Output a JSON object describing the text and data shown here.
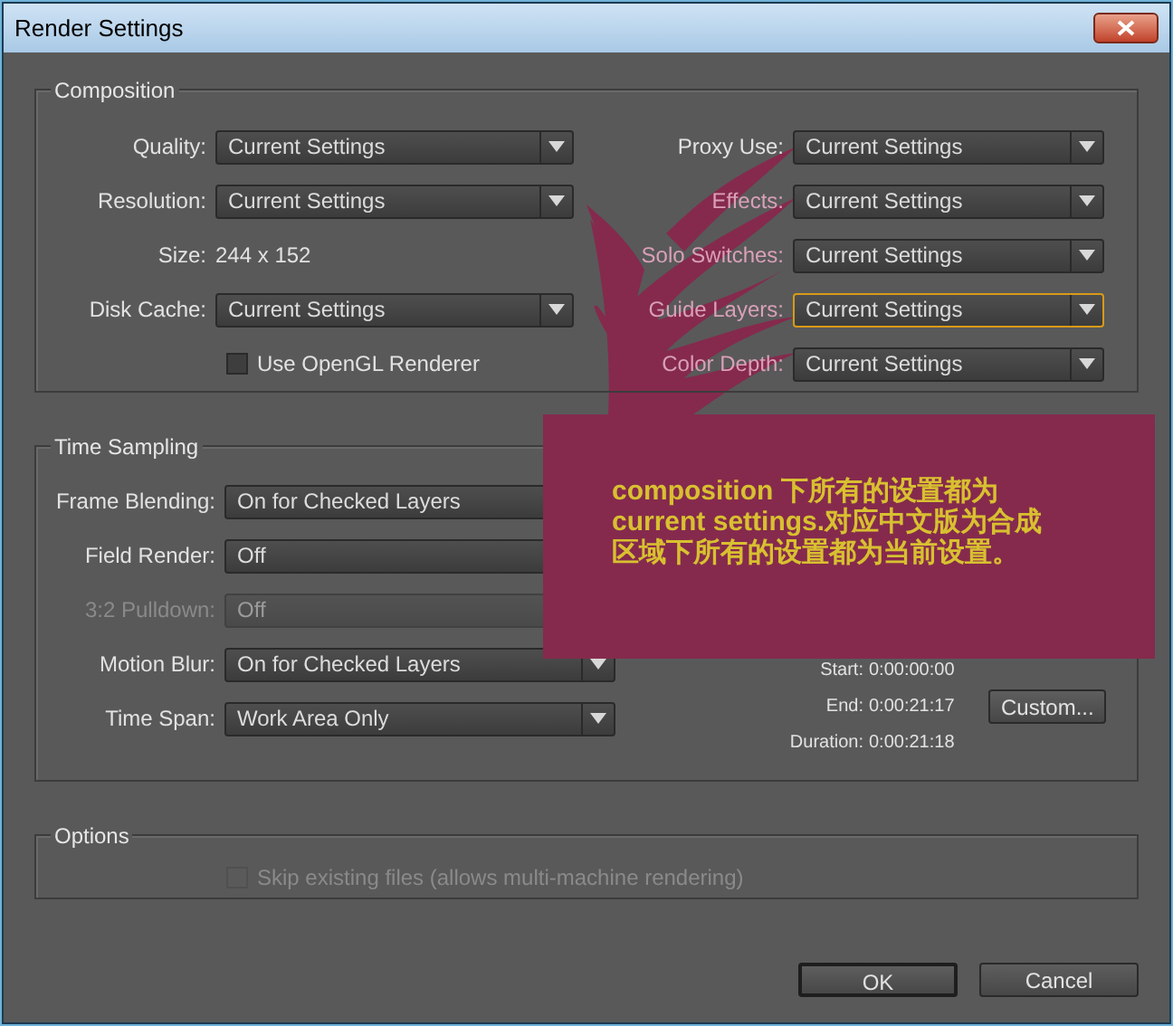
{
  "window": {
    "title": "Render Settings"
  },
  "composition": {
    "title": "Composition",
    "left": [
      {
        "kind": "select",
        "label": "Quality:",
        "value": "Current Settings"
      },
      {
        "kind": "select",
        "label": "Resolution:",
        "value": "Current Settings"
      },
      {
        "kind": "text",
        "label": "Size:",
        "value": "244 x 152"
      },
      {
        "kind": "select",
        "label": "Disk Cache:",
        "value": "Current Settings"
      },
      {
        "kind": "checkbox",
        "label": "Use OpenGL Renderer",
        "checked": false
      }
    ],
    "right": [
      {
        "label": "Proxy Use:",
        "value": "Current Settings",
        "focused": false
      },
      {
        "label": "Effects:",
        "value": "Current Settings",
        "focused": false
      },
      {
        "label": "Solo Switches:",
        "value": "Current Settings",
        "focused": false
      },
      {
        "label": "Guide Layers:",
        "value": "Current Settings",
        "focused": true
      },
      {
        "label": "Color Depth:",
        "value": "Current Settings",
        "focused": false
      }
    ]
  },
  "time_sampling": {
    "title": "Time Sampling",
    "rows": [
      {
        "label": "Frame Blending:",
        "value": "On for Checked Layers",
        "disabled": false
      },
      {
        "label": "Field Render:",
        "value": "Off",
        "disabled": false
      },
      {
        "label": "3:2 Pulldown:",
        "value": "Off",
        "disabled": true
      },
      {
        "label": "Motion Blur:",
        "value": "On for Checked Layers",
        "disabled": false
      },
      {
        "label": "Time Span:",
        "value": "Work Area Only",
        "disabled": false
      }
    ],
    "times": [
      {
        "label": "Start:",
        "value": "0:00:00:00"
      },
      {
        "label": "End:",
        "value": "0:00:21:17"
      },
      {
        "label": "Duration:",
        "value": "0:00:21:18"
      }
    ],
    "custom_button": "Custom..."
  },
  "options": {
    "title": "Options",
    "checkbox": {
      "label": "Skip existing files (allows multi-machine rendering)",
      "checked": false,
      "disabled": true
    }
  },
  "buttons": [
    {
      "label": "OK",
      "default": true
    },
    {
      "label": "Cancel",
      "default": false
    }
  ],
  "annotation": {
    "text": "composition 下所有的设置都为 current settings.对应中文版为合成区域下所有的设置都为当前设置。"
  }
}
